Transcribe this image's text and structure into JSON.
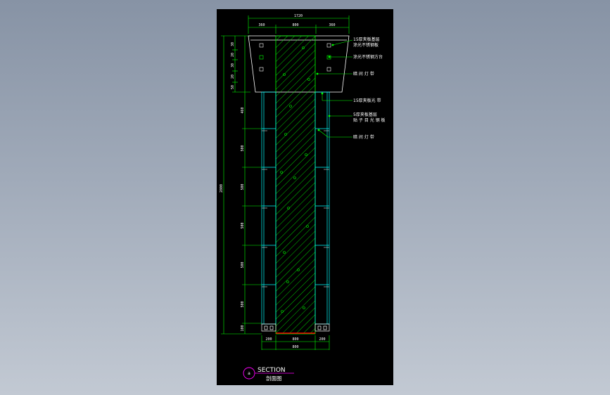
{
  "drawing": {
    "title_en": "SECTION",
    "title_zh": "剖面图",
    "section_tag": "a",
    "colors": {
      "background": "#000000",
      "column_outline": "#ffffff",
      "hatch": "#00ff00",
      "cabinet": "#00ffff",
      "dimension": "#00ff00",
      "base_line": "#ff0000",
      "tag_circle": "#ff00ff"
    },
    "dimensions": {
      "top_overall": "1720",
      "top_segments": [
        "360",
        "800",
        "360"
      ],
      "bottom_overall": "800",
      "bottom_segments": [
        "200",
        "800",
        "200"
      ],
      "left_top_stack": [
        "30",
        "20",
        "30",
        "20",
        "50"
      ],
      "left_overall": "2800",
      "left_rows": [
        "460",
        "500",
        "500",
        "500",
        "500",
        "500",
        "100"
      ]
    },
    "annotations": [
      "15厚夹板基层",
      "涂光不锈钢板",
      "涂光不锈钢方台",
      "暗 间 灯 带",
      "15厚夹板光 带",
      "5厚夹板基层",
      "贴 子 目 光 钢 板",
      "暗 间 灯 带"
    ]
  }
}
